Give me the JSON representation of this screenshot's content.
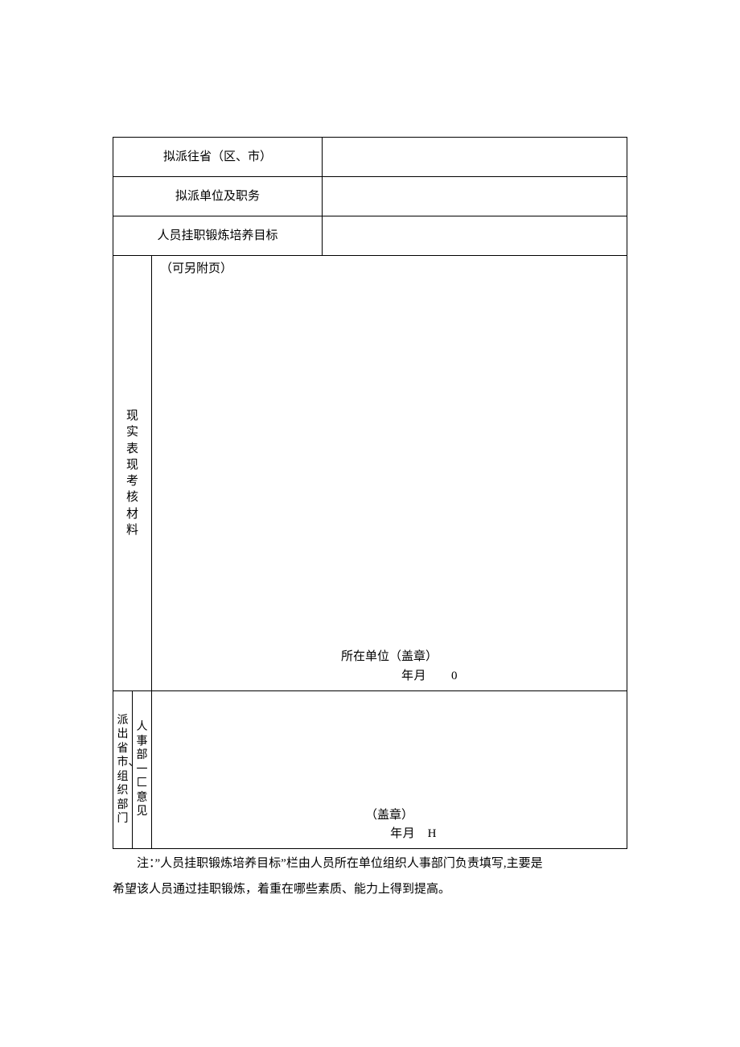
{
  "rows": {
    "r1_label": "拟派往省（区、市）",
    "r1_value": "",
    "r2_label": "拟派单位及职务",
    "r2_value": "",
    "r3_label": "人员挂职锻炼培养目标",
    "r3_value": ""
  },
  "kao": {
    "vlabel": "现实表现考核材料",
    "note": "（可另附页）",
    "sign_unit": "所在单位（盖章）",
    "sign_date": "年月  0"
  },
  "dept": {
    "vlabel_left": "派出省市、组织部门",
    "vlabel_right": "人事部一 匚意见",
    "sign_seal": "（盖章）",
    "sign_date": "年月 H"
  },
  "note": {
    "line1": "注：”人员挂职锻炼培养目标”栏由人员所在单位组织人事部门负责填写,主要是",
    "line2": "希望该人员通过挂职锻炼，着重在哪些素质、能力上得到提高。"
  }
}
